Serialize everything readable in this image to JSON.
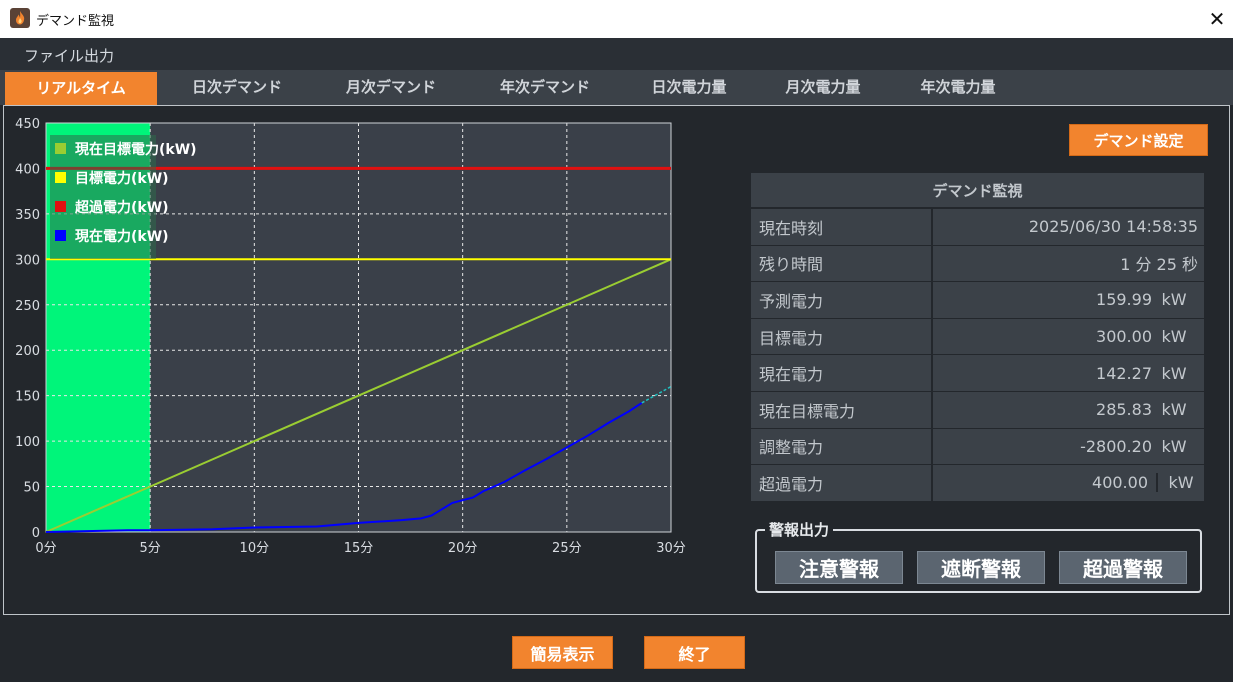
{
  "window": {
    "title": "デマンド監視",
    "close_glyph": "✕"
  },
  "menu": {
    "file_output": "ファイル出力"
  },
  "tabs": [
    {
      "label": "リアルタイム",
      "active": true
    },
    {
      "label": "日次デマンド",
      "active": false
    },
    {
      "label": "月次デマンド",
      "active": false
    },
    {
      "label": "年次デマンド",
      "active": false
    },
    {
      "label": "日次電力量",
      "active": false
    },
    {
      "label": "月次電力量",
      "active": false
    },
    {
      "label": "年次電力量",
      "active": false
    }
  ],
  "demand_settings_button": "デマンド設定",
  "demand_table": {
    "title": "デマンド監視",
    "rows": [
      {
        "label": "現在時刻",
        "value": "2025/06/30 14:58:35",
        "unit": ""
      },
      {
        "label": "残り時間",
        "value": "1 分 25 秒",
        "unit": ""
      },
      {
        "label": "予測電力",
        "value": "159.99",
        "unit": "kW"
      },
      {
        "label": "目標電力",
        "value": "300.00",
        "unit": "kW"
      },
      {
        "label": "現在電力",
        "value": "142.27",
        "unit": "kW"
      },
      {
        "label": "現在目標電力",
        "value": "285.83",
        "unit": "kW"
      },
      {
        "label": "調整電力",
        "value": "-2800.20",
        "unit": "kW"
      },
      {
        "label": "超過電力",
        "value": "400.00",
        "unit": "kW"
      }
    ]
  },
  "alarm": {
    "legend": "警報出力",
    "buttons": [
      "注意警報",
      "遮断警報",
      "超過警報"
    ]
  },
  "footer": {
    "simple_view": "簡易表示",
    "exit": "終了"
  },
  "colors": {
    "accent": "#f2842e",
    "current_target": "#9acd32",
    "target": "#ffff00",
    "excess": "#e01010",
    "current": "#0000ff",
    "forecast": "#20c0c0",
    "time_band": "#00f57a"
  },
  "chart_data": {
    "type": "line",
    "xlim": [
      0,
      30
    ],
    "ylim": [
      0,
      450
    ],
    "x_ticks": [
      0,
      5,
      10,
      15,
      20,
      25,
      30
    ],
    "x_tick_labels": [
      "0分",
      "5分",
      "10分",
      "15分",
      "20分",
      "25分",
      "30分"
    ],
    "y_ticks": [
      0,
      50,
      100,
      150,
      200,
      250,
      300,
      350,
      400,
      450
    ],
    "y_tick_labels": [
      "0",
      "50",
      "100",
      "150",
      "200",
      "250",
      "300",
      "350",
      "400",
      "450"
    ],
    "grid": true,
    "legend_position": "top-left",
    "highlight_band": {
      "x_start": 0,
      "x_end": 5
    },
    "series": [
      {
        "name": "現在目標電力(kW)",
        "color": "#9acd32",
        "x": [
          0,
          30
        ],
        "y": [
          0,
          300
        ]
      },
      {
        "name": "目標電力(kW)",
        "color": "#ffff00",
        "x": [
          0,
          30
        ],
        "y": [
          300,
          300
        ]
      },
      {
        "name": "超過電力(kW)",
        "color": "#e01010",
        "x": [
          0,
          30
        ],
        "y": [
          400,
          400
        ]
      },
      {
        "name": "現在電力(kW)",
        "color": "#0000ff",
        "x": [
          0,
          4,
          5,
          8,
          10,
          13,
          15,
          17,
          18,
          18.5,
          19,
          19.5,
          20,
          20.5,
          21,
          22,
          23,
          24,
          25,
          26,
          27,
          28,
          28.6
        ],
        "y": [
          0,
          2,
          2,
          3,
          5,
          6,
          10,
          13,
          15,
          18,
          25,
          32,
          35,
          38,
          45,
          55,
          68,
          80,
          93,
          106,
          120,
          133,
          142
        ]
      },
      {
        "name": "",
        "color": "#20c0c0",
        "dashed": true,
        "x": [
          28.6,
          30
        ],
        "y": [
          142,
          160
        ]
      }
    ]
  }
}
